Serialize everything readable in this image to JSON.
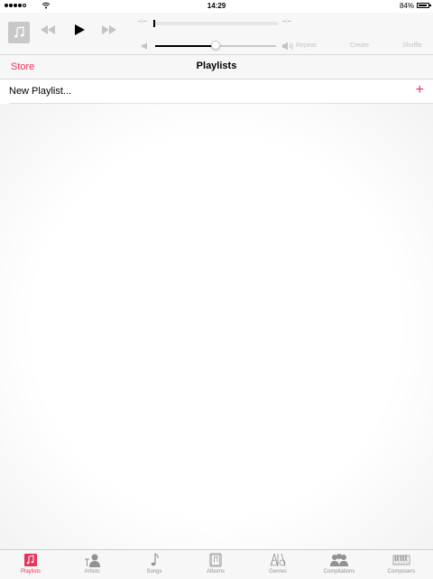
{
  "status_bar": {
    "time": "14:29",
    "battery": "84%"
  },
  "player": {
    "elapsed": "--:--",
    "remaining": "--:--",
    "volume_level": 0.5,
    "repeat_label": "Repeat",
    "create_label": "Create",
    "shuffle_label": "Shuffle"
  },
  "nav": {
    "store_label": "Store",
    "title": "Playlists"
  },
  "list": {
    "new_playlist_label": "New Playlist..."
  },
  "tabs": [
    {
      "label": "Playlists",
      "icon": "playlists-icon"
    },
    {
      "label": "Artists",
      "icon": "artists-icon"
    },
    {
      "label": "Songs",
      "icon": "songs-icon"
    },
    {
      "label": "Albums",
      "icon": "albums-icon"
    },
    {
      "label": "Genres",
      "icon": "genres-icon"
    },
    {
      "label": "Compilations",
      "icon": "compilations-icon"
    },
    {
      "label": "Composers",
      "icon": "composers-icon"
    }
  ],
  "colors": {
    "accent": "#e8325a",
    "inactive": "#929292"
  }
}
